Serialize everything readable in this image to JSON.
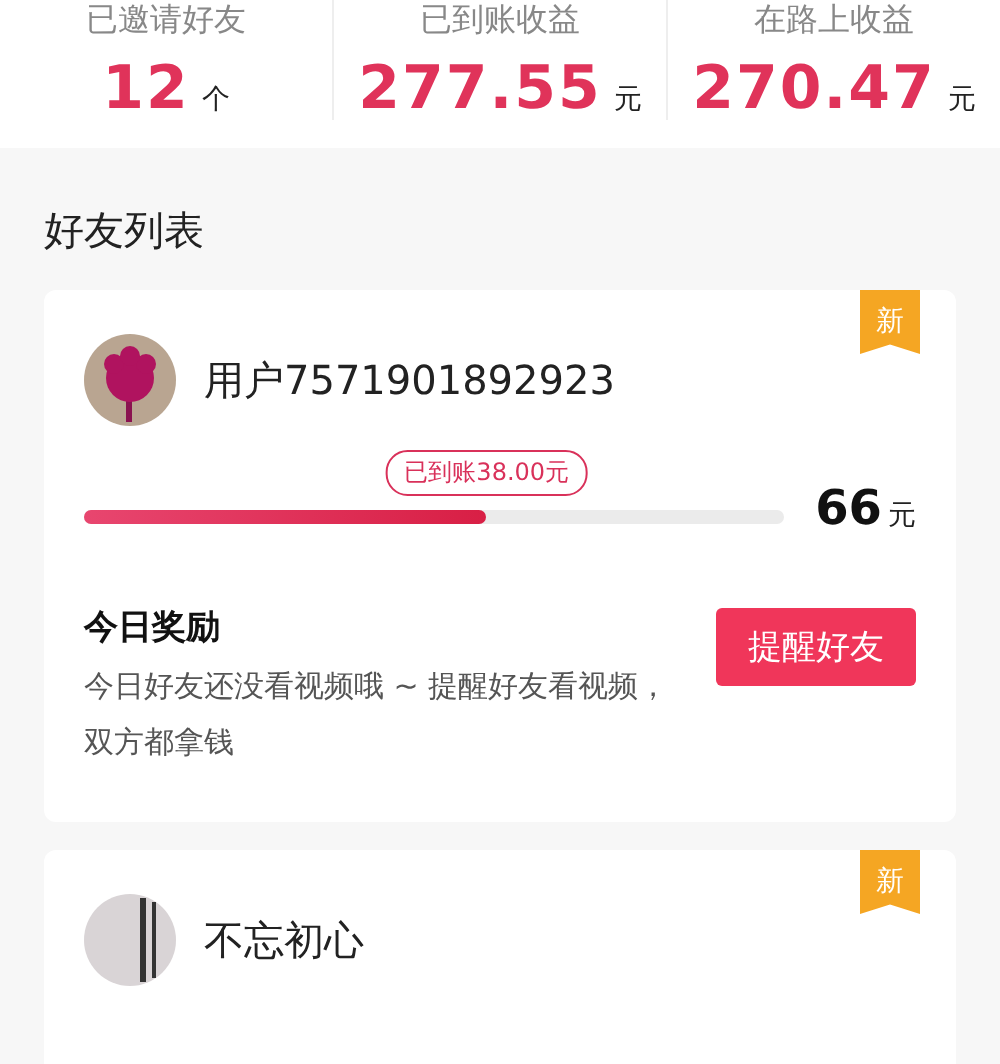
{
  "stats": [
    {
      "label": "已邀请好友",
      "value": "12",
      "unit": "个"
    },
    {
      "label": "已到账收益",
      "value": "277.55",
      "unit": "元"
    },
    {
      "label": "在路上收益",
      "value": "270.47",
      "unit": "元"
    }
  ],
  "section_title": "好友列表",
  "friends": [
    {
      "name": "用户7571901892923",
      "badge": "新",
      "kind": "flower",
      "received": "已到账38.00元",
      "level": 0.576,
      "total": "66",
      "total_unit": "元",
      "reward_title": "今日奖励",
      "reward_text": "今日好友还没看视频哦 ~ 提醒好友看视频，双方都拿钱",
      "button": "提醒好友"
    },
    {
      "name": "不忘初心",
      "badge": "新",
      "kind": "photo"
    }
  ]
}
